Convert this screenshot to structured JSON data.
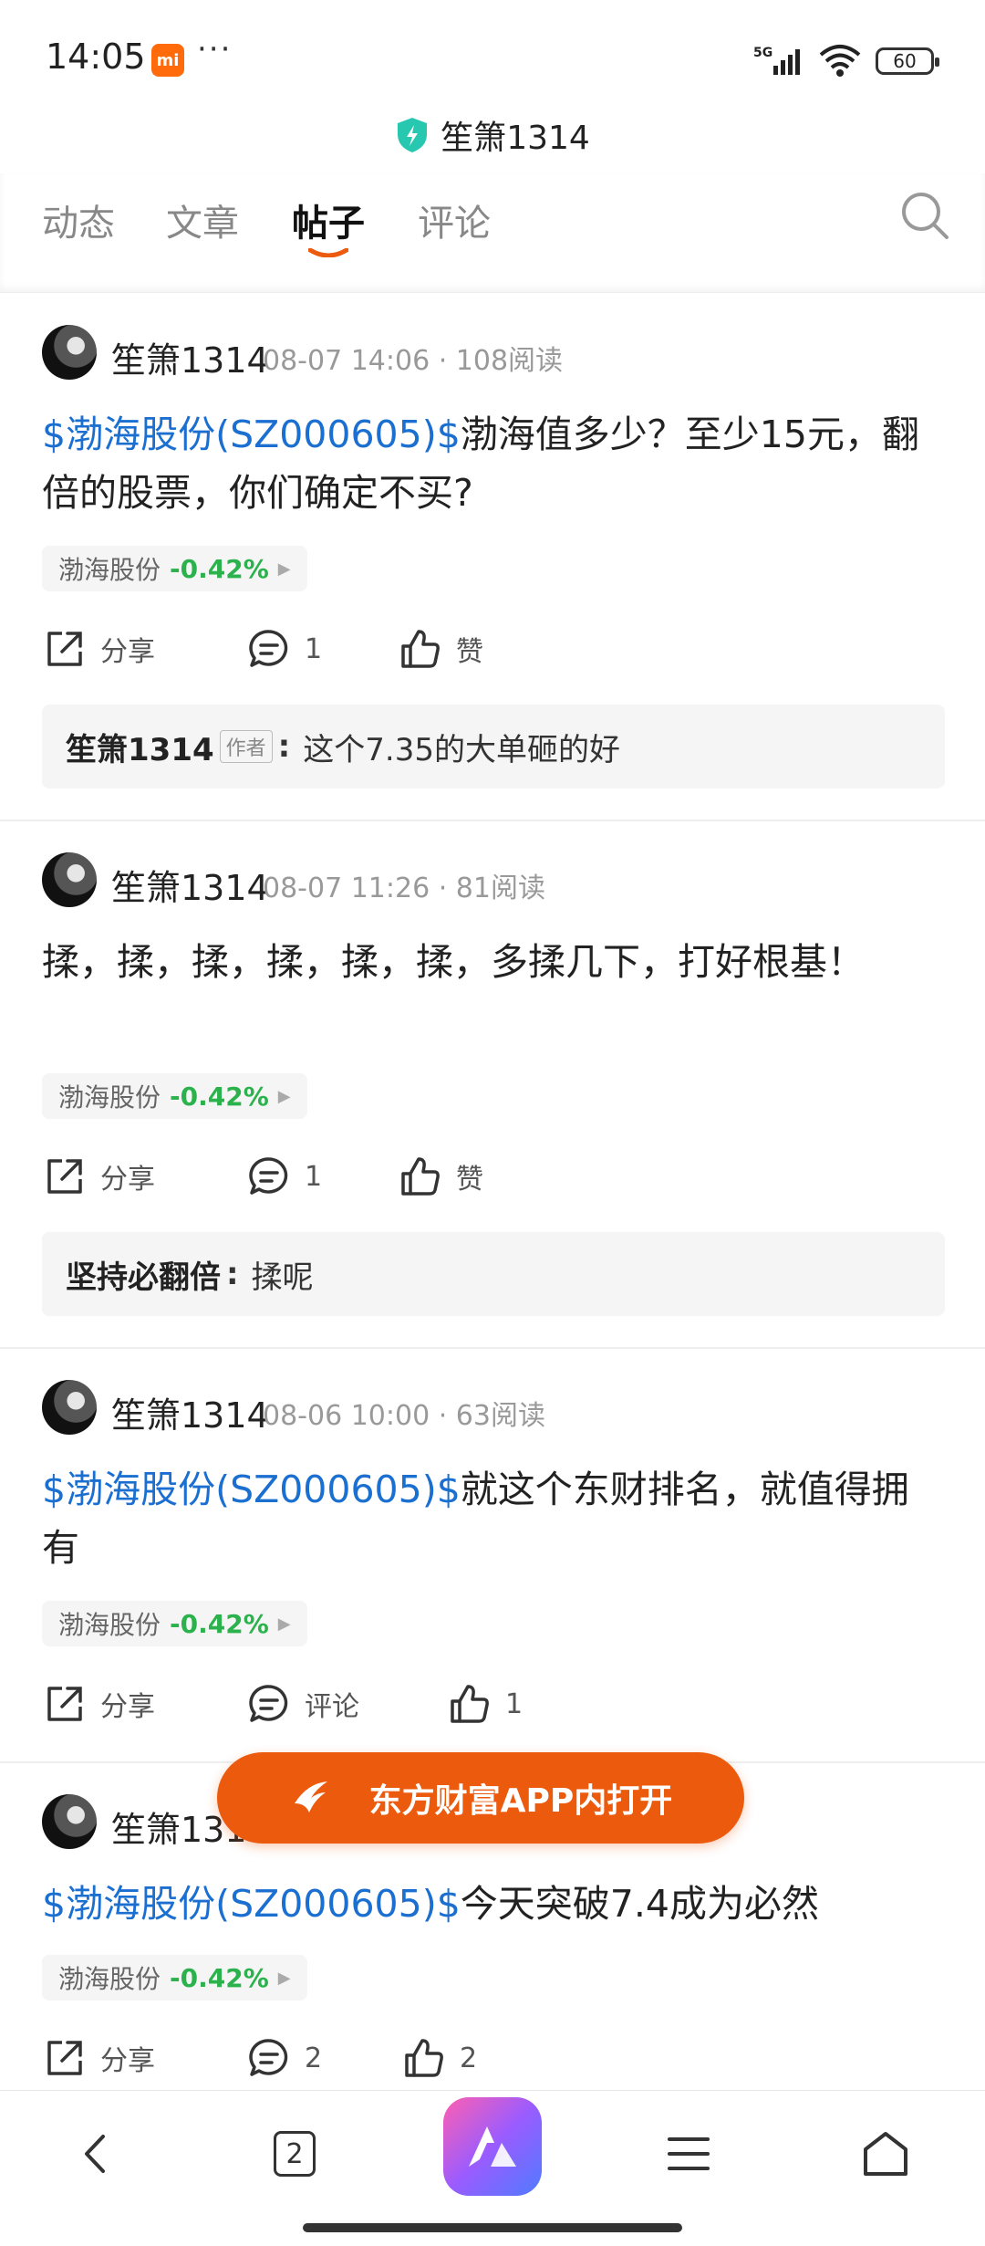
{
  "status_bar": {
    "time": "14:05",
    "app_badge": "mi",
    "battery": "60",
    "network": "5G"
  },
  "header": {
    "title": "笙箫1314"
  },
  "tabs": [
    {
      "label": "动态"
    },
    {
      "label": "文章"
    },
    {
      "label": "帖子",
      "active": true
    },
    {
      "label": "评论"
    }
  ],
  "posts": [
    {
      "author": "笙箫1314",
      "meta": "08-07 14:06 · 108阅读",
      "content_stock": "$渤海股份(SZ000605)$",
      "content_text": "渤海值多少？至少15元，翻倍的股票，你们确定不买?",
      "stock_name": "渤海股份",
      "stock_change": "-0.42%",
      "share": "分享",
      "comments": "1",
      "likes": "赞",
      "reply": {
        "name": "笙箫1314",
        "badge": "作者",
        "colon": ":",
        "text": "这个7.35的大单砸的好"
      }
    },
    {
      "author": "笙箫1314",
      "meta": "08-07 11:26 · 81阅读",
      "content_stock": "",
      "content_text": "揉，揉，揉，揉，揉，揉，多揉几下，打好根基！",
      "stock_name": "渤海股份",
      "stock_change": "-0.42%",
      "share": "分享",
      "comments": "1",
      "likes": "赞",
      "reply": {
        "name": "坚持必翻倍",
        "colon": ":",
        "text": "揉呢"
      }
    },
    {
      "author": "笙箫1314",
      "meta": "08-06 10:00 · 63阅读",
      "content_stock": "$渤海股份(SZ000605)$",
      "content_text": "就这个东财排名，就值得拥有",
      "stock_name": "渤海股份",
      "stock_change": "-0.42%",
      "share": "分享",
      "comments": "评论",
      "likes": "1"
    },
    {
      "author": "笙箫1314",
      "content_stock": "$渤海股份(SZ000605)$",
      "content_text": "今天突破7.4成为必然",
      "stock_name": "渤海股份",
      "stock_change": "-0.42%",
      "share": "分享",
      "comments": "2",
      "likes": "2"
    }
  ],
  "open_app": {
    "label": "东方财富APP内打开"
  },
  "bottom_nav": {
    "tab_count": "2"
  },
  "colors": {
    "accent": "#ec5a0e",
    "link": "#1a6fd1",
    "up_down": "#2bb24c"
  }
}
